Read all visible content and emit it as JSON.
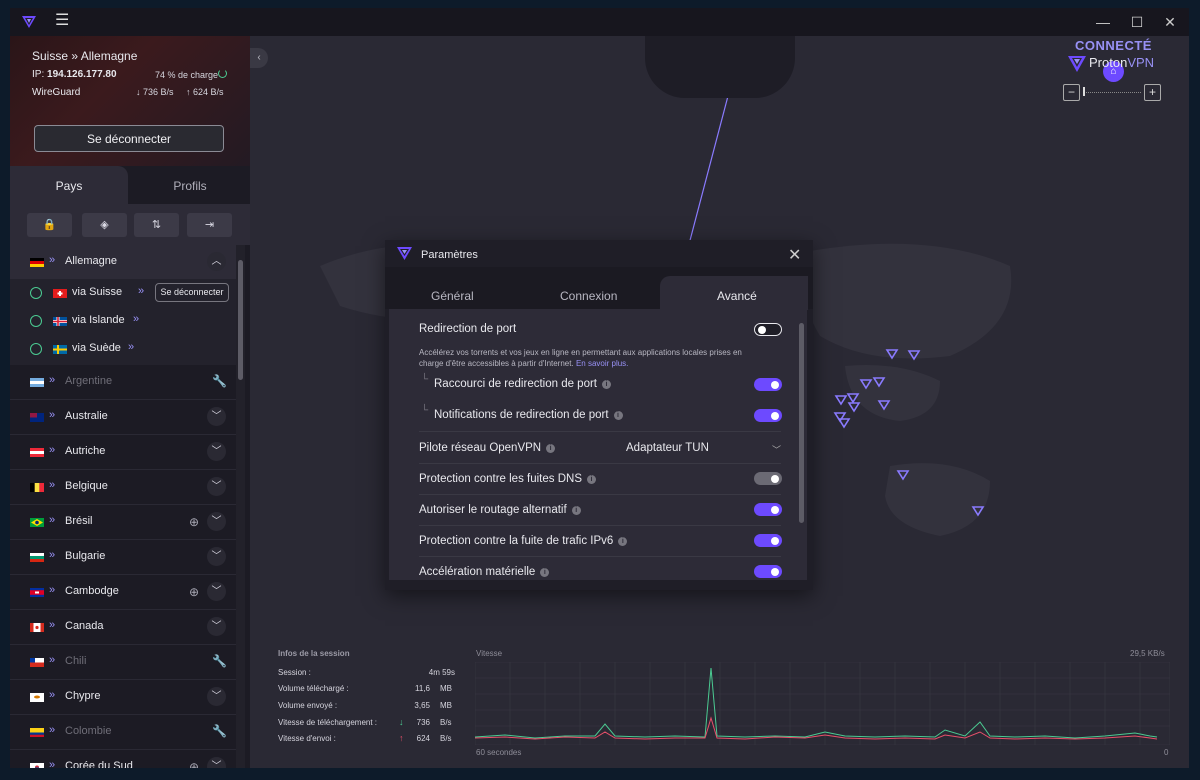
{
  "window": {
    "minimize": "—",
    "maximize": "☐",
    "close": "✕",
    "menu": "☰"
  },
  "connection": {
    "title": "Suisse » Allemagne",
    "ip_label": "IP:",
    "ip": "194.126.177.80",
    "load": "74 % de charge",
    "protocol": "WireGuard",
    "down": "↓ 736 B/s",
    "up": "↑ 624 B/s",
    "disconnect": "Se déconnecter"
  },
  "tabs": {
    "countries": "Pays",
    "profiles": "Profils"
  },
  "filters": [
    {
      "icon": "secure-core-icon",
      "glyph": "🔒"
    },
    {
      "icon": "shield-icon",
      "glyph": "◈"
    },
    {
      "icon": "p2p-icon",
      "glyph": "⇅"
    },
    {
      "icon": "tor-icon",
      "glyph": "⇥"
    }
  ],
  "countries": [
    {
      "name": "Allemagne",
      "flag": "de",
      "expanded": true
    },
    {
      "name": "Argentine",
      "flag": "ar",
      "dim": true
    },
    {
      "name": "Australie",
      "flag": "au"
    },
    {
      "name": "Autriche",
      "flag": "at"
    },
    {
      "name": "Belgique",
      "flag": "be"
    },
    {
      "name": "Brésil",
      "flag": "br",
      "globe": true
    },
    {
      "name": "Bulgarie",
      "flag": "bg"
    },
    {
      "name": "Cambodge",
      "flag": "kh",
      "globe": true
    },
    {
      "name": "Canada",
      "flag": "ca"
    },
    {
      "name": "Chili",
      "flag": "cl",
      "dim": true
    },
    {
      "name": "Chypre",
      "flag": "cy"
    },
    {
      "name": "Colombie",
      "flag": "co",
      "dim": true
    },
    {
      "name": "Corée du Sud",
      "flag": "kr",
      "globe": true
    }
  ],
  "servers": [
    {
      "name": "via Suisse",
      "flag": "ch",
      "button": "Se déconnecter"
    },
    {
      "name": "via Islande",
      "flag": "is"
    },
    {
      "name": "via Suède",
      "flag": "se"
    }
  ],
  "map": {
    "status": "CONNECTÉ",
    "brand_proton": "Proton",
    "brand_vpn": "VPN",
    "zoom_out": "−",
    "zoom_in": "+"
  },
  "settings": {
    "title": "Paramètres",
    "close": "✕",
    "tabs": [
      "Général",
      "Connexion",
      "Avancé"
    ],
    "items": {
      "port_forwarding": "Redirection de port",
      "description": "Accélérez vos torrents et vos jeux en ligne en permettant aux applications locales prises en charge d'être accessibles à partir d'Internet.",
      "learn_more": "En savoir plus.",
      "port_shortcut": "Raccourci de redirection de port",
      "port_notifications": "Notifications de redirection de port",
      "openvpn_driver": "Pilote réseau OpenVPN",
      "openvpn_driver_value": "Adaptateur TUN",
      "dns_leak": "Protection contre les fuites DNS",
      "alt_routing": "Autoriser le routage alternatif",
      "ipv6_leak": "Protection contre la fuite de trafic IPv6",
      "hw_accel": "Accélération matérielle"
    },
    "toggles": {
      "port_forwarding": false,
      "port_shortcut": true,
      "port_notifications": true,
      "dns_leak": true,
      "alt_routing": true,
      "ipv6_leak": true,
      "hw_accel": true
    }
  },
  "session": {
    "title": "Infos de la session",
    "rows": [
      {
        "label": "Session :",
        "value": "4m 59s",
        "unit": ""
      },
      {
        "label": "Volume téléchargé :",
        "value": "11,6",
        "unit": "MB"
      },
      {
        "label": "Volume envoyé :",
        "value": "3,65",
        "unit": "MB"
      },
      {
        "label": "Vitesse de téléchargement :",
        "value": "736",
        "unit": "B/s",
        "arrow": "↓"
      },
      {
        "label": "Vitesse d'envoi :",
        "value": "624",
        "unit": "B/s",
        "arrow": "↑"
      }
    ],
    "chart_title": "Vitesse",
    "chart_max": "29,5 KB/s",
    "chart_left": "60 secondes",
    "chart_right": "0"
  },
  "colors": {
    "accent": "#6d4aff",
    "accent_light": "#9891f5",
    "green": "#4bcb92",
    "red": "#e8506a"
  }
}
